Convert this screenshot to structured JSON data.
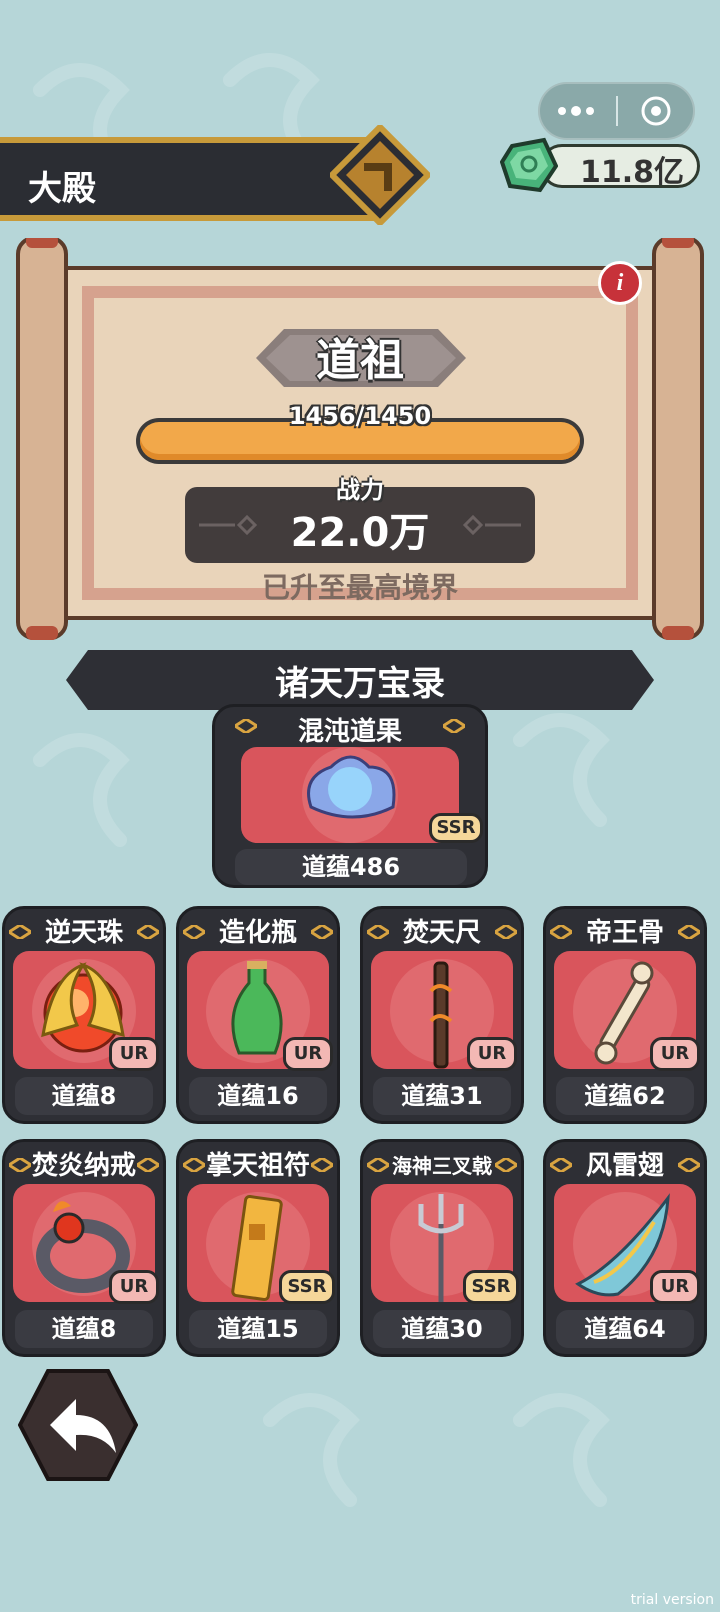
{
  "header": {
    "title": "大殿"
  },
  "currency": {
    "value": "11.8亿",
    "icon": "jade-gem-icon"
  },
  "realm": {
    "name": "道祖",
    "progress_text": "1456/1450",
    "progress_fraction": 1.0,
    "power_label": "战力",
    "power_value": "22.0万",
    "status": "已升至最高境界"
  },
  "section": {
    "title": "诸天万宝录"
  },
  "featured": {
    "title": "混沌道果",
    "rarity": "SSR",
    "footer": "道蕴486",
    "icon": "chaos-fruit-icon"
  },
  "items": [
    {
      "title": "逆天珠",
      "rarity": "UR",
      "footer": "道蕴8",
      "icon": "flame-orb-icon"
    },
    {
      "title": "造化瓶",
      "rarity": "UR",
      "footer": "道蕴16",
      "icon": "green-vase-icon"
    },
    {
      "title": "焚天尺",
      "rarity": "UR",
      "footer": "道蕴31",
      "icon": "burning-rod-icon"
    },
    {
      "title": "帝王骨",
      "rarity": "UR",
      "footer": "道蕴62",
      "icon": "bone-icon"
    },
    {
      "title": "焚炎纳戒",
      "rarity": "UR",
      "footer": "道蕴8",
      "icon": "fire-ring-icon"
    },
    {
      "title": "掌天祖符",
      "rarity": "SSR",
      "footer": "道蕴15",
      "icon": "golden-talisman-icon"
    },
    {
      "title": "海神三叉戟",
      "rarity": "SSR",
      "footer": "道蕴30",
      "icon": "trident-icon"
    },
    {
      "title": "风雷翅",
      "rarity": "UR",
      "footer": "道蕴64",
      "icon": "thunder-wing-icon"
    }
  ],
  "watermark": "trial version"
}
